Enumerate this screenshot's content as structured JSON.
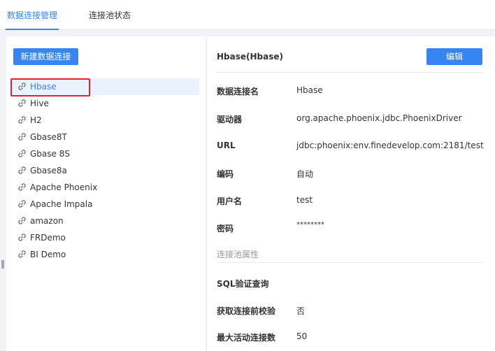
{
  "tabs": [
    {
      "label": "数据连接管理",
      "active": true
    },
    {
      "label": "连接池状态",
      "active": false
    }
  ],
  "left": {
    "new_button": "新建数据连接",
    "connections": [
      {
        "name": "Hbase",
        "selected": true
      },
      {
        "name": "Hive"
      },
      {
        "name": "H2"
      },
      {
        "name": "Gbase8T"
      },
      {
        "name": "Gbase 8S"
      },
      {
        "name": "Gbase8a"
      },
      {
        "name": "Apache Phoenix"
      },
      {
        "name": "Apache Impala"
      },
      {
        "name": "amazon"
      },
      {
        "name": "FRDemo"
      },
      {
        "name": "BI Demo"
      }
    ],
    "item_icon": "link-icon"
  },
  "detail": {
    "title": "Hbase(Hbase)",
    "edit_button": "编辑",
    "fields": [
      {
        "label": "数据连接名",
        "value": "Hbase"
      },
      {
        "label": "驱动器",
        "value": "org.apache.phoenix.jdbc.PhoenixDriver"
      },
      {
        "label": "URL",
        "value": "jdbc:phoenix:env.finedevelop.com:2181/test"
      },
      {
        "label": "编码",
        "value": "自动"
      },
      {
        "label": "用户名",
        "value": "test"
      },
      {
        "label": "密码",
        "value": "********"
      }
    ],
    "pool_section_title": "连接池属性",
    "pool_fields": [
      {
        "label": "SQL验证查询",
        "value": ""
      },
      {
        "label": "获取连接前校验",
        "value": "否"
      },
      {
        "label": "最大活动连接数",
        "value": "50"
      }
    ]
  },
  "colors": {
    "accent": "#3685f2",
    "highlight": "#e5202e",
    "selected_bg": "#eaf2fe"
  }
}
